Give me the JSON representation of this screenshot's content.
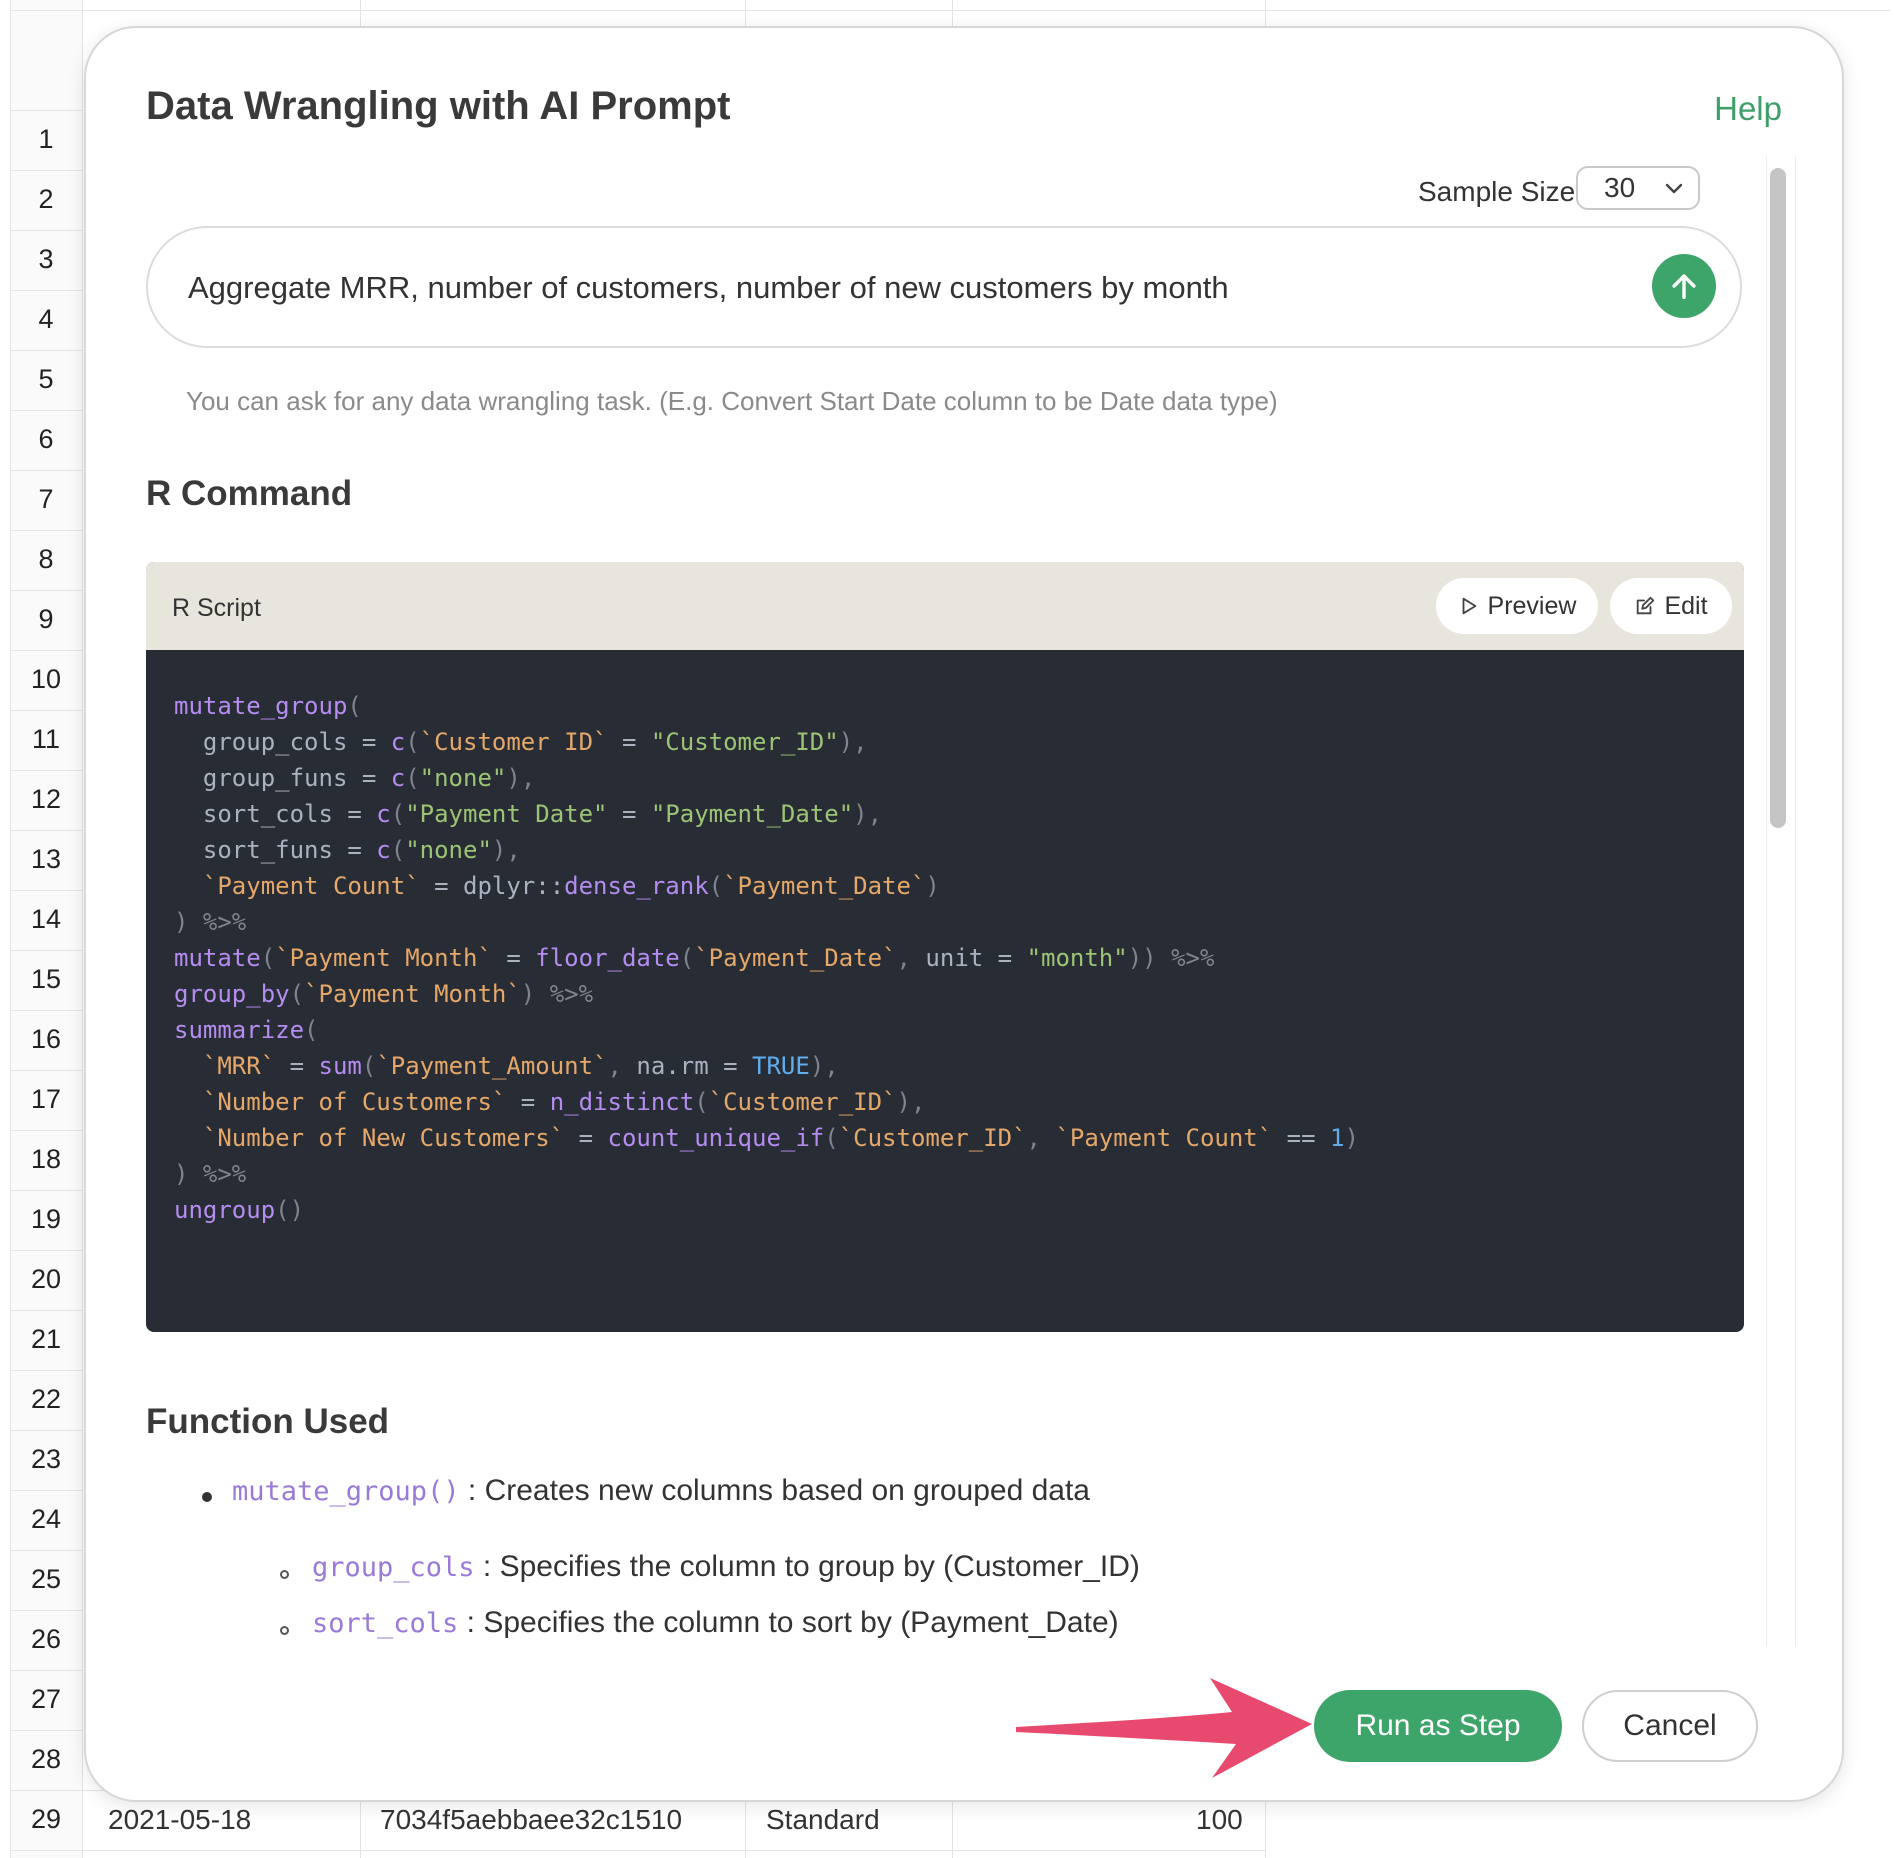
{
  "spreadsheet": {
    "row_numbers": [
      "1",
      "2",
      "3",
      "4",
      "5",
      "6",
      "7",
      "8",
      "9",
      "10",
      "11",
      "12",
      "13",
      "14",
      "15",
      "16",
      "17",
      "18",
      "19",
      "20",
      "21",
      "22",
      "23",
      "24",
      "25",
      "26",
      "27",
      "28",
      "29"
    ],
    "last_row": {
      "date": "2021-05-18",
      "customer_id": "7034f5aebbaee32c1510",
      "plan": "Standard",
      "amount": "100"
    }
  },
  "dialog": {
    "title": "Data Wrangling with AI Prompt",
    "help_label": "Help",
    "sample_size_label": "Sample Size",
    "sample_size_value": "30",
    "prompt_text": "Aggregate MRR, number of customers, number of new customers by month",
    "hint": "You can ask for any data wrangling task. (E.g. Convert Start Date column to be Date data type)",
    "r_command_title": "R Command",
    "script": {
      "label": "R Script",
      "preview_label": "Preview",
      "edit_label": "Edit",
      "code_lines": [
        "mutate_group(",
        "  group_cols = c(`Customer ID` = \"Customer_ID\"),",
        "  group_funs = c(\"none\"),",
        "  sort_cols = c(\"Payment Date\" = \"Payment_Date\"),",
        "  sort_funs = c(\"none\"),",
        "  `Payment Count` = dplyr::dense_rank(`Payment_Date`)",
        ") %>%",
        "mutate(`Payment Month` = floor_date(`Payment_Date`, unit = \"month\")) %>%",
        "group_by(`Payment Month`) %>%",
        "summarize(",
        "  `MRR` = sum(`Payment_Amount`, na.rm = TRUE),",
        "  `Number of Customers` = n_distinct(`Customer_ID`),",
        "  `Number of New Customers` = count_unique_if(`Customer_ID`, `Payment Count` == 1)",
        ") %>%",
        "ungroup()"
      ]
    },
    "function_used_title": "Function Used",
    "functions": [
      {
        "name": "mutate_group()",
        "desc": ": Creates new columns based on grouped data"
      },
      {
        "name": "group_cols",
        "desc": ": Specifies the column to group by (Customer_ID)"
      },
      {
        "name": "sort_cols",
        "desc": ": Specifies the column to sort by (Payment_Date)"
      }
    ],
    "run_label": "Run as Step",
    "cancel_label": "Cancel"
  },
  "colors": {
    "accent_green": "#3ea56a",
    "annotation_arrow": "#e84a6f",
    "code_bg": "#282c34"
  }
}
